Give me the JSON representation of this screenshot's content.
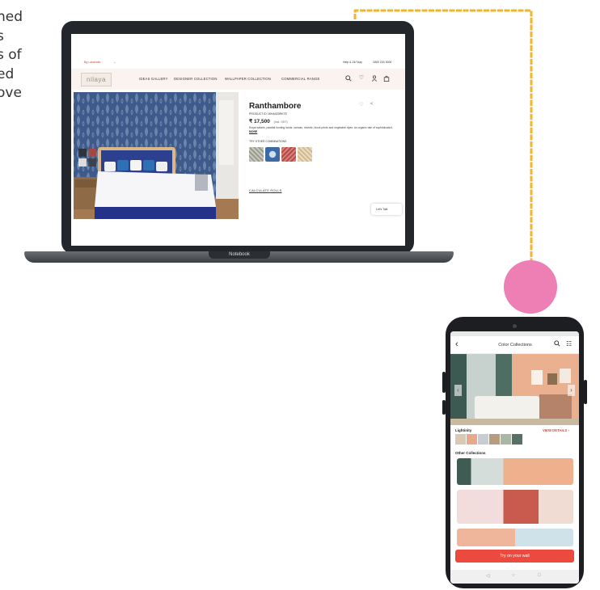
{
  "side_text": {
    "lines": [
      "hed",
      "s",
      "s of",
      "ed",
      "ove",
      "",
      "",
      ".",
      ""
    ]
  },
  "laptop": {
    "label": "Notebook",
    "site": {
      "topbar": {
        "location": "Bg Lanavatin",
        "help": "Help & 24/7day",
        "phone": "1800 203 3000"
      },
      "brand": "nilaya",
      "nav": [
        "IDEAS GALLERY",
        "DESIGNER COLLECTION",
        "WALLPAPER COLLECTION",
        "COMMERCIAL RANGE"
      ],
      "icons": [
        "search-icon",
        "heart-icon",
        "user-icon",
        "bag-icon"
      ],
      "product": {
        "title": "Ranthambore",
        "code": "PRODUCT ID: WHA020RKTE",
        "price": "₹ 17,500",
        "price_note": "(Incl. GST)",
        "description": "Royal safaris, palatial hunting lands, canvas, rivulets, block prints and vegetable dyes: an organic tale of sophisticated,",
        "more": "MORE",
        "try_label": "TRY OTHER COMBINATIONS",
        "calculate": "CALCULATE ROLLS",
        "chat": "Let's Talk"
      }
    }
  },
  "phone": {
    "header_title": "Color Collections",
    "section_lightness": "Lightinity",
    "view_details": "VIEW DETAILS",
    "section_other": "Other Collections",
    "cta": "Try on your wall"
  },
  "colors": {
    "accent": "#ec4a3f",
    "connector": "#f3b62b",
    "pink": "#ee7fb4",
    "device": "#23262b"
  }
}
